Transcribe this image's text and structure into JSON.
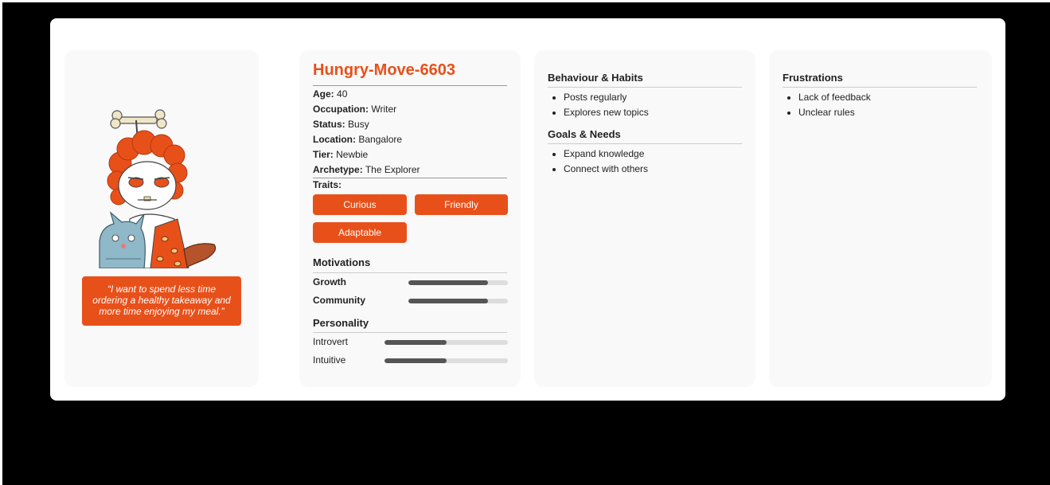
{
  "persona": {
    "quote": "“I want to spend less time ordering a healthy takeaway and more time enjoying my meal.”",
    "name": "Hungry-Move-6603",
    "facts": [
      {
        "label": "Age:",
        "value": "40"
      },
      {
        "label": "Occupation:",
        "value": "Writer"
      },
      {
        "label": "Status:",
        "value": "Busy"
      },
      {
        "label": "Location:",
        "value": "Bangalore"
      },
      {
        "label": "Tier:",
        "value": "Newbie"
      },
      {
        "label": "Archetype:",
        "value": "The Explorer"
      }
    ],
    "traits_label": "Traits:",
    "traits": [
      "Curious",
      "Friendly",
      "Adaptable"
    ],
    "motivations": {
      "title": "Motivations",
      "items": [
        {
          "label": "Growth",
          "level": 0.8
        },
        {
          "label": "Community",
          "level": 0.8
        }
      ]
    },
    "personality": {
      "title": "Personality",
      "items": [
        {
          "label": "Introvert",
          "level": 0.5
        },
        {
          "label": "Intuitive",
          "level": 0.5
        }
      ]
    },
    "behaviour": {
      "title": "Behaviour & Habits",
      "items": [
        "Posts regularly",
        "Explores new topics"
      ]
    },
    "goals": {
      "title": "Goals & Needs",
      "items": [
        "Expand knowledge",
        "Connect with others"
      ]
    },
    "frustrations": {
      "title": "Frustrations",
      "items": [
        "Lack of feedback",
        "Unclear rules"
      ]
    }
  },
  "colors": {
    "accent": "#e8501a",
    "bar_fill": "#555555",
    "bar_track": "#dddddd"
  },
  "icons": {
    "avatar": "reddit-caveman-avatar-icon"
  }
}
